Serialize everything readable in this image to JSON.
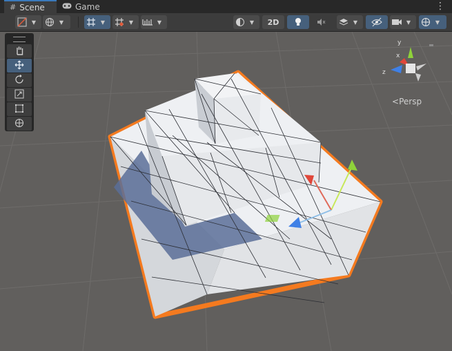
{
  "tabs": [
    {
      "label": "Scene",
      "icon": "grid-icon",
      "active": true
    },
    {
      "label": "Game",
      "icon": "gamepad-icon",
      "active": false
    }
  ],
  "toolbar": {
    "mode_2d_label": "2D",
    "menu_icon": "kebab-icon"
  },
  "tools": [
    {
      "name": "hand-tool",
      "icon": "hand-icon"
    },
    {
      "name": "move-tool",
      "icon": "move-icon",
      "selected": true
    },
    {
      "name": "rotate-tool",
      "icon": "rotate-icon"
    },
    {
      "name": "scale-tool",
      "icon": "scale-icon"
    },
    {
      "name": "rect-tool",
      "icon": "rect-icon"
    },
    {
      "name": "transform-tool",
      "icon": "transform-icon"
    }
  ],
  "gizmo": {
    "projection_label": "Persp",
    "axis_x": "x",
    "axis_y": "y",
    "axis_z": "z"
  },
  "colors": {
    "selection_outline": "#f47a1f",
    "axis_x": "#e0473a",
    "axis_y": "#8fd23a",
    "axis_z": "#3f80e6",
    "background": "#615f5d"
  }
}
